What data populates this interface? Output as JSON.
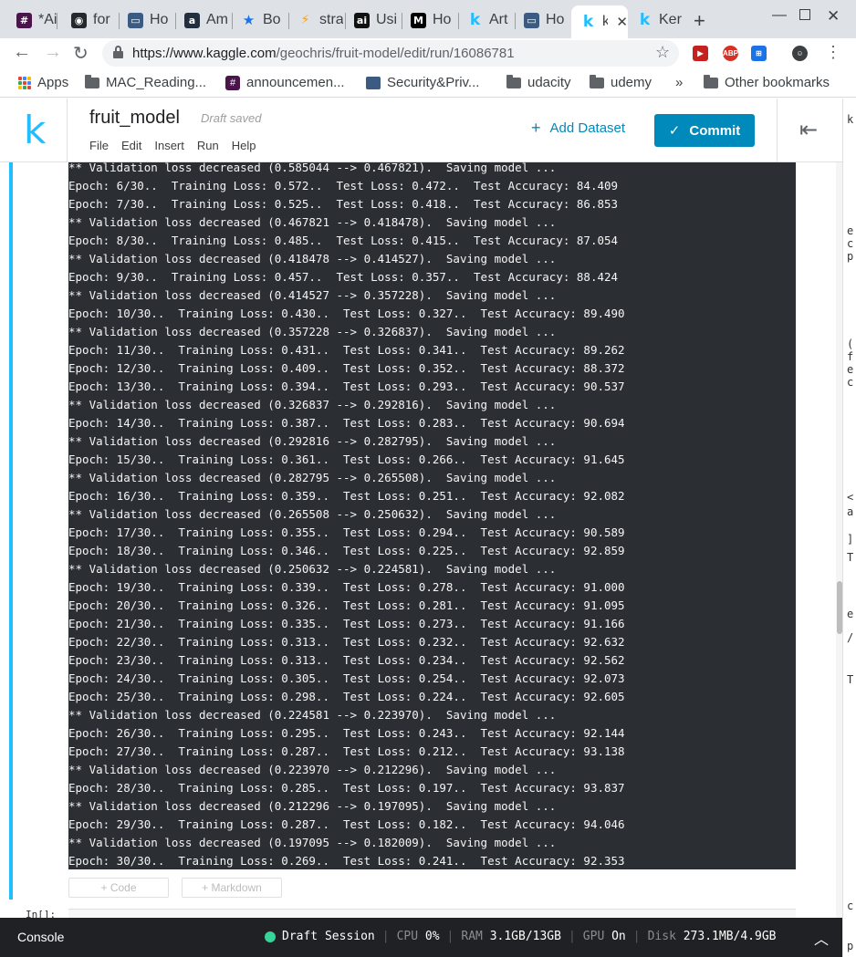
{
  "browser": {
    "tabs": [
      {
        "title": "*Ai",
        "icon": "slack-icon",
        "color": "#4a154b",
        "glyph": "#"
      },
      {
        "title": "for",
        "icon": "github-icon",
        "color": "#24292e",
        "glyph": "◉"
      },
      {
        "title": "Ho",
        "icon": "window-icon",
        "color": "#3b5b82",
        "glyph": "▭"
      },
      {
        "title": "Am",
        "icon": "amazon-icon",
        "color": "#232f3e",
        "glyph": "a"
      },
      {
        "title": "Bo",
        "icon": "star-icon",
        "color": "#1a73e8",
        "glyph": "★"
      },
      {
        "title": "stra",
        "icon": "bolt-icon",
        "color": "#f0a020",
        "glyph": "⚡"
      },
      {
        "title": "Usi",
        "icon": "ai-icon",
        "color": "#111111",
        "glyph": "ai"
      },
      {
        "title": "Ho",
        "icon": "medium-icon",
        "color": "#000000",
        "glyph": "M"
      },
      {
        "title": "Art",
        "icon": "kaggle-icon",
        "color": "#20beff",
        "glyph": "k"
      },
      {
        "title": "Ho",
        "icon": "window-icon",
        "color": "#3b5b82",
        "glyph": "▭"
      },
      {
        "title": "k",
        "icon": "kaggle-icon",
        "color": "#20beff",
        "glyph": "k",
        "active": true
      },
      {
        "title": "Ker",
        "icon": "kaggle-icon",
        "color": "#20beff",
        "glyph": "k"
      }
    ],
    "url_host": "https://www.kaggle.com",
    "url_path": "/geochris/fruit-model/edit/run/16086781",
    "bookmarks": {
      "apps": "Apps",
      "items": [
        "MAC_Reading...",
        "announcemen...",
        "Security&Priv...",
        "udacity",
        "udemy"
      ],
      "overflow": "»",
      "other": "Other bookmarks"
    }
  },
  "kaggle": {
    "logo": "k",
    "notebook_title": "fruit_model",
    "save_status": "Draft saved",
    "menu": [
      "File",
      "Edit",
      "Insert",
      "Run",
      "Help"
    ],
    "add_dataset": "Add Dataset",
    "commit": "Commit",
    "accent": "#20beff",
    "button_color": "#008abc"
  },
  "output_lines": [
    "** Validation loss decreased (0.585044 --> 0.467821).  Saving model ...",
    "Epoch: 6/30..  Training Loss: 0.572..  Test Loss: 0.472..  Test Accuracy: 84.409",
    "Epoch: 7/30..  Training Loss: 0.525..  Test Loss: 0.418..  Test Accuracy: 86.853",
    "** Validation loss decreased (0.467821 --> 0.418478).  Saving model ...",
    "Epoch: 8/30..  Training Loss: 0.485..  Test Loss: 0.415..  Test Accuracy: 87.054",
    "** Validation loss decreased (0.418478 --> 0.414527).  Saving model ...",
    "Epoch: 9/30..  Training Loss: 0.457..  Test Loss: 0.357..  Test Accuracy: 88.424",
    "** Validation loss decreased (0.414527 --> 0.357228).  Saving model ...",
    "Epoch: 10/30..  Training Loss: 0.430..  Test Loss: 0.327..  Test Accuracy: 89.490",
    "** Validation loss decreased (0.357228 --> 0.326837).  Saving model ...",
    "Epoch: 11/30..  Training Loss: 0.431..  Test Loss: 0.341..  Test Accuracy: 89.262",
    "Epoch: 12/30..  Training Loss: 0.409..  Test Loss: 0.352..  Test Accuracy: 88.372",
    "Epoch: 13/30..  Training Loss: 0.394..  Test Loss: 0.293..  Test Accuracy: 90.537",
    "** Validation loss decreased (0.326837 --> 0.292816).  Saving model ...",
    "Epoch: 14/30..  Training Loss: 0.387..  Test Loss: 0.283..  Test Accuracy: 90.694",
    "** Validation loss decreased (0.292816 --> 0.282795).  Saving model ...",
    "Epoch: 15/30..  Training Loss: 0.361..  Test Loss: 0.266..  Test Accuracy: 91.645",
    "** Validation loss decreased (0.282795 --> 0.265508).  Saving model ...",
    "Epoch: 16/30..  Training Loss: 0.359..  Test Loss: 0.251..  Test Accuracy: 92.082",
    "** Validation loss decreased (0.265508 --> 0.250632).  Saving model ...",
    "Epoch: 17/30..  Training Loss: 0.355..  Test Loss: 0.294..  Test Accuracy: 90.589",
    "Epoch: 18/30..  Training Loss: 0.346..  Test Loss: 0.225..  Test Accuracy: 92.859",
    "** Validation loss decreased (0.250632 --> 0.224581).  Saving model ...",
    "Epoch: 19/30..  Training Loss: 0.339..  Test Loss: 0.278..  Test Accuracy: 91.000",
    "Epoch: 20/30..  Training Loss: 0.326..  Test Loss: 0.281..  Test Accuracy: 91.095",
    "Epoch: 21/30..  Training Loss: 0.335..  Test Loss: 0.273..  Test Accuracy: 91.166",
    "Epoch: 22/30..  Training Loss: 0.313..  Test Loss: 0.232..  Test Accuracy: 92.632",
    "Epoch: 23/30..  Training Loss: 0.313..  Test Loss: 0.234..  Test Accuracy: 92.562",
    "Epoch: 24/30..  Training Loss: 0.305..  Test Loss: 0.254..  Test Accuracy: 92.073",
    "Epoch: 25/30..  Training Loss: 0.298..  Test Loss: 0.224..  Test Accuracy: 92.605",
    "** Validation loss decreased (0.224581 --> 0.223970).  Saving model ...",
    "Epoch: 26/30..  Training Loss: 0.295..  Test Loss: 0.243..  Test Accuracy: 92.144",
    "Epoch: 27/30..  Training Loss: 0.287..  Test Loss: 0.212..  Test Accuracy: 93.138",
    "** Validation loss decreased (0.223970 --> 0.212296).  Saving model ...",
    "Epoch: 28/30..  Training Loss: 0.285..  Test Loss: 0.197..  Test Accuracy: 93.837",
    "** Validation loss decreased (0.212296 --> 0.197095).  Saving model ...",
    "Epoch: 29/30..  Training Loss: 0.287..  Test Loss: 0.182..  Test Accuracy: 94.046",
    "** Validation loss decreased (0.197095 --> 0.182009).  Saving model ...",
    "Epoch: 30/30..  Training Loss: 0.269..  Test Loss: 0.241..  Test Accuracy: 92.353"
  ],
  "cell": {
    "add_code": "+ Code",
    "add_markdown": "+ Markdown",
    "in_prompt": "In[]:"
  },
  "status": {
    "console": "Console",
    "session": "Draft Session",
    "cpu_label": "CPU",
    "cpu_value": "0%",
    "ram_label": "RAM",
    "ram_value": "3.1GB/13GB",
    "gpu_label": "GPU",
    "gpu_value": "On",
    "disk_label": "Disk",
    "disk_value": "273.1MB/4.9GB",
    "session_color": "#37d49a"
  },
  "right_strip_chars": [
    "k",
    "e",
    "c",
    "p",
    "(",
    "f",
    "e",
    "c",
    "<",
    "a",
    "]",
    "T",
    "e",
    "/",
    "T",
    "c",
    "p"
  ]
}
